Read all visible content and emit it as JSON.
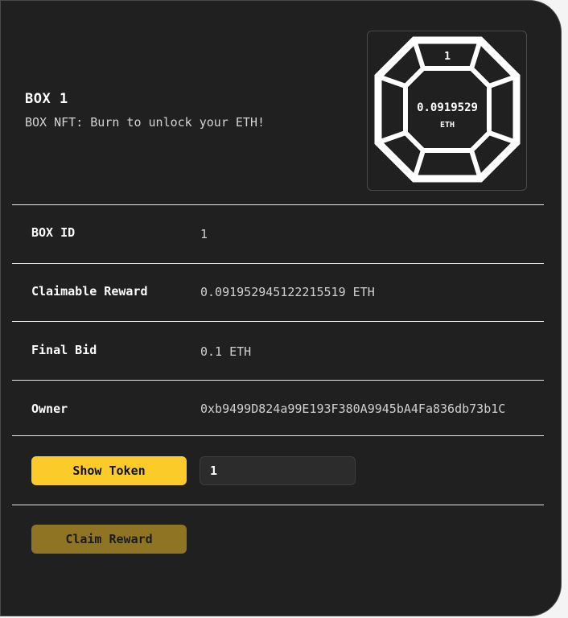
{
  "box": {
    "title": "BOX 1",
    "subtitle": "BOX NFT: Burn to unlock your ETH!"
  },
  "nft_image": {
    "id_label": "1",
    "amount": "0.0919529",
    "unit": "ETH"
  },
  "details": {
    "box_id_label": "BOX ID",
    "box_id_value": "1",
    "claimable_label": "Claimable Reward",
    "claimable_value": "0.091952945122215519 ETH",
    "final_bid_label": "Final Bid",
    "final_bid_value": "0.1 ETH",
    "owner_label": "Owner",
    "owner_value": "0xb9499D824a99E193F380A9945bA4Fa836db73b1C"
  },
  "actions": {
    "show_token_label": "Show Token",
    "token_input_value": "1",
    "claim_reward_label": "Claim Reward"
  },
  "colors": {
    "accent": "#fbcb2a",
    "accent_disabled": "#8e7423",
    "card_bg": "#202020"
  }
}
